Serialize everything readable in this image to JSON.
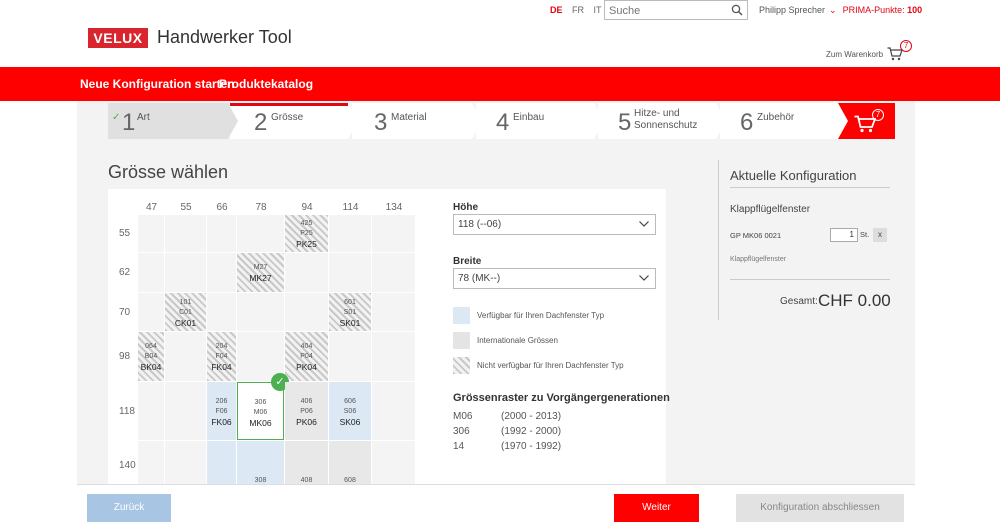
{
  "header": {
    "logo_text": "VELUX",
    "app_title": "Handwerker Tool",
    "languages": [
      "DE",
      "FR",
      "IT"
    ],
    "active_language": "DE",
    "search_placeholder": "Suche",
    "user_name": "Philipp Sprecher",
    "points_label": "PRIMA-Punkte:",
    "points_value": "100",
    "cart_link": "Zum Warenkorb",
    "cart_count": "7"
  },
  "nav": {
    "items": [
      "Neue Konfiguration starten",
      "Produktekatalog"
    ]
  },
  "steps": [
    {
      "num": "1",
      "label": "Art",
      "state": "done"
    },
    {
      "num": "2",
      "label": "Grösse",
      "state": "current"
    },
    {
      "num": "3",
      "label": "Material",
      "state": "todo"
    },
    {
      "num": "4",
      "label": "Einbau",
      "state": "todo"
    },
    {
      "num": "5",
      "label": "Hitze- und Sonnenschutz",
      "state": "todo"
    },
    {
      "num": "6",
      "label": "Zubehör",
      "state": "todo"
    }
  ],
  "steps_cart_count": "7",
  "section_title": "Grösse wählen",
  "grid": {
    "columns": [
      "47",
      "55",
      "66",
      "78",
      "94",
      "114",
      "134"
    ],
    "rows": [
      "55",
      "62",
      "70",
      "98",
      "118",
      "140"
    ],
    "cells": [
      {
        "r": 0,
        "c": 4,
        "type": "hatch",
        "lines": [
          "425",
          "P25"
        ],
        "code": "PK25"
      },
      {
        "r": 1,
        "c": 3,
        "type": "hatch",
        "lines": [
          "M27"
        ],
        "code": "MK27"
      },
      {
        "r": 2,
        "c": 1,
        "type": "hatch",
        "lines": [
          "101",
          "C01"
        ],
        "code": "CK01"
      },
      {
        "r": 2,
        "c": 5,
        "type": "hatch",
        "lines": [
          "601",
          "S01"
        ],
        "code": "SK01"
      },
      {
        "r": 3,
        "c": 0,
        "type": "hatch",
        "lines": [
          "064",
          "B04"
        ],
        "code": "BK04"
      },
      {
        "r": 3,
        "c": 2,
        "type": "hatch",
        "lines": [
          "204",
          "F04"
        ],
        "code": "FK04"
      },
      {
        "r": 3,
        "c": 4,
        "type": "hatch",
        "lines": [
          "404",
          "P04"
        ],
        "code": "PK04"
      },
      {
        "r": 4,
        "c": 2,
        "type": "avail",
        "lines": [
          "206",
          "F06"
        ],
        "code": "FK06"
      },
      {
        "r": 4,
        "c": 3,
        "type": "selected",
        "lines": [
          "306",
          "M06"
        ],
        "code": "MK06"
      },
      {
        "r": 4,
        "c": 4,
        "type": "intl",
        "lines": [
          "406",
          "P06"
        ],
        "code": "PK06"
      },
      {
        "r": 4,
        "c": 5,
        "type": "avail",
        "lines": [
          "606",
          "S06"
        ],
        "code": "SK06"
      },
      {
        "r": 5,
        "c": 2,
        "type": "avail",
        "lines": [],
        "code": ""
      },
      {
        "r": 5,
        "c": 3,
        "type": "avail",
        "lines": [
          "308"
        ],
        "code": ""
      },
      {
        "r": 5,
        "c": 4,
        "type": "intl",
        "lines": [
          "408"
        ],
        "code": ""
      },
      {
        "r": 5,
        "c": 5,
        "type": "intl",
        "lines": [
          "608"
        ],
        "code": ""
      }
    ]
  },
  "form": {
    "height_label": "Höhe",
    "height_value": "118 (--06)",
    "width_label": "Breite",
    "width_value": "78 (MK--)"
  },
  "legend": [
    {
      "type": "avail",
      "text": "Verfügbar für Ihren Dachfenster Typ"
    },
    {
      "type": "intl",
      "text": "Internationale Grössen"
    },
    {
      "type": "hatch",
      "text": "Nicht verfügbar für Ihren Dachfenster Typ"
    }
  ],
  "history": {
    "title": "Grössenraster zu Vorgängergenerationen",
    "rows": [
      {
        "code": "M06",
        "years": "(2000 - 2013)"
      },
      {
        "code": "306",
        "years": "(1992 - 2000)"
      },
      {
        "code": "14",
        "years": "(1970 - 1992)"
      }
    ]
  },
  "sidebar": {
    "title": "Aktuelle Konfiguration",
    "product": "Klappflügelfenster",
    "code": "GP MK06 0021",
    "qty": "1",
    "qty_unit": "St.",
    "remove": "x",
    "note": "Klappflügelfenster",
    "total_label": "Gesamt:",
    "total_value": "CHF 0.00"
  },
  "footer": {
    "back": "Zurück",
    "next": "Weiter",
    "finish": "Konfiguration abschliessen"
  },
  "colors": {
    "brand_red": "#ff0000",
    "available_blue": "#dce8f4",
    "selected_green": "#4caf50"
  }
}
